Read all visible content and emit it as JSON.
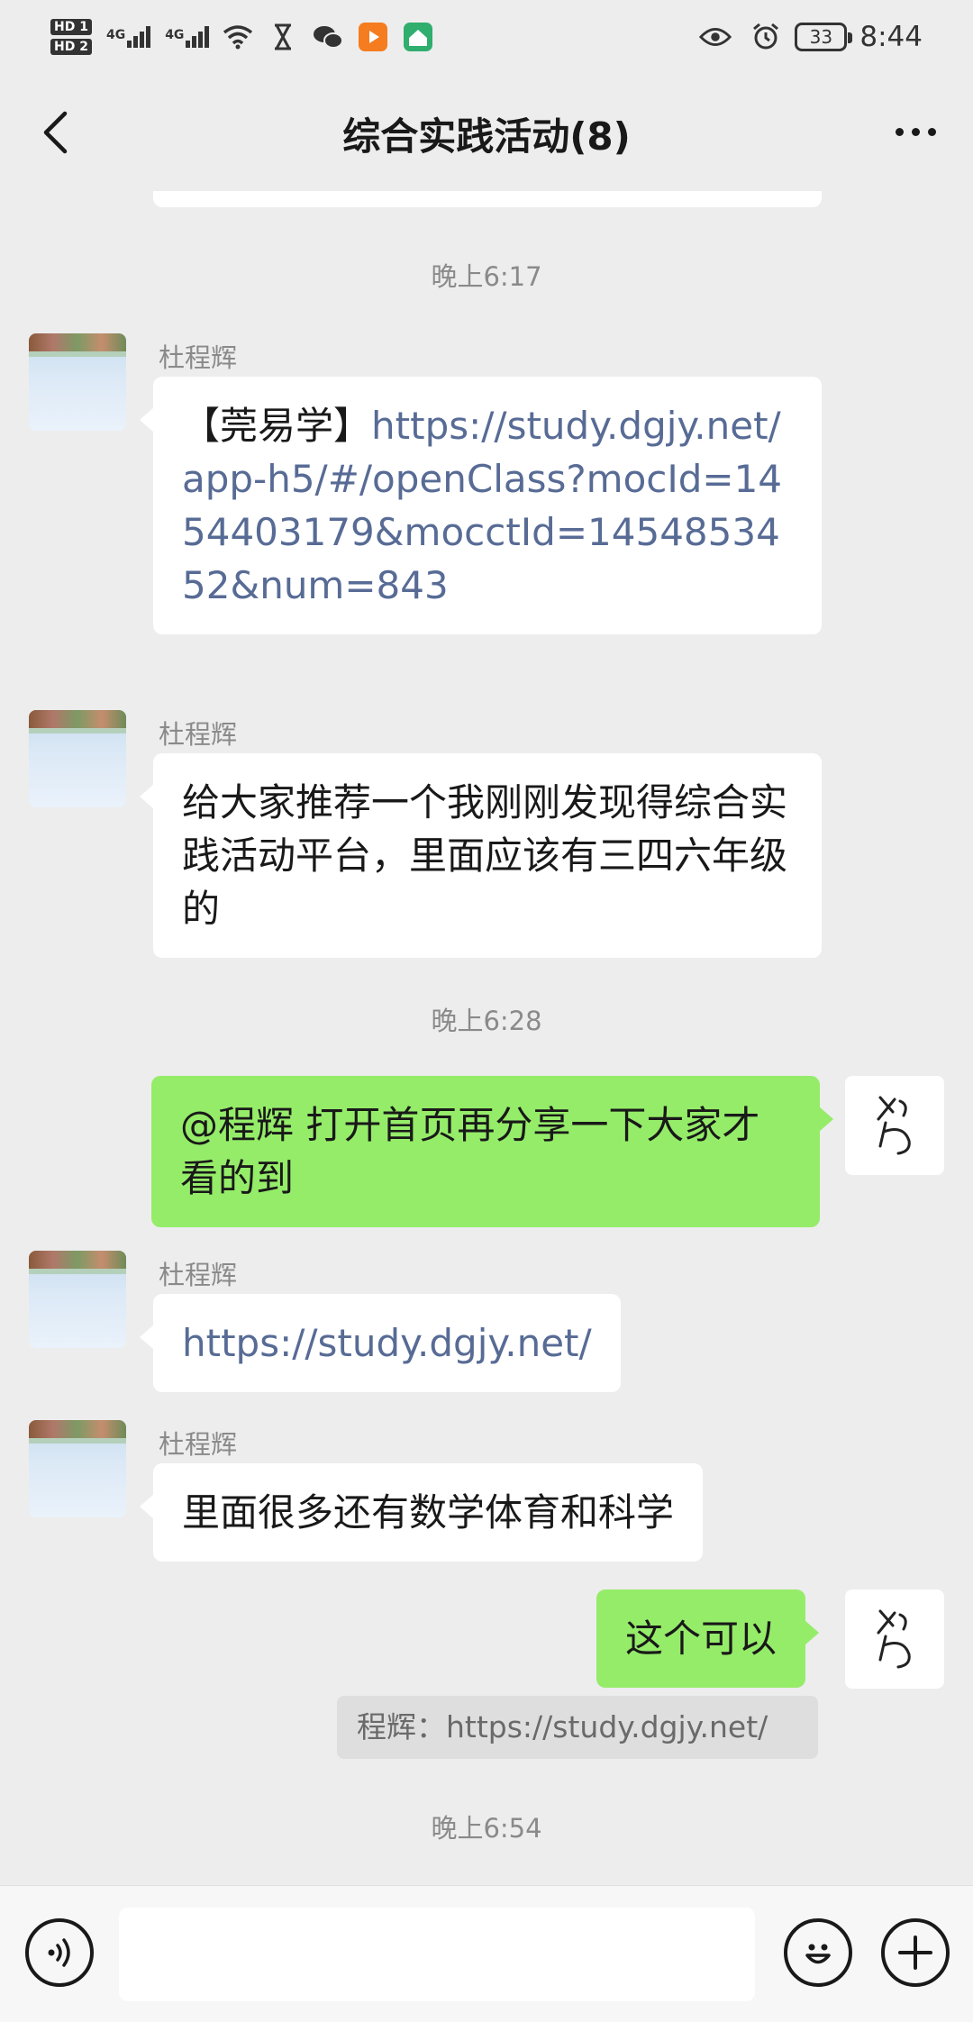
{
  "status_bar": {
    "sim1_label": "HD 1",
    "sim2_label": "HD 2",
    "net1": "4G",
    "net2": "4G",
    "battery": "33",
    "time": "8:44",
    "icons": [
      "signal-icon",
      "signal-icon",
      "wifi-icon",
      "hourglass-icon",
      "wechat-icon",
      "video-app-icon",
      "home-app-icon",
      "eye-icon",
      "alarm-icon",
      "battery-icon"
    ]
  },
  "header": {
    "title": "综合实践活动(8)",
    "back_icon": "chevron-left-icon",
    "more_icon": "more-dots-icon"
  },
  "messages": [
    {
      "type": "timestamp",
      "text": "晚上6:17"
    },
    {
      "type": "incoming",
      "sender": "杜程辉",
      "prefix": "【莞易学】",
      "link": "https://study.dgjy.net/app-h5/#/openClass?mocId=1454403179&mocctId=1454853452&num=843"
    },
    {
      "type": "incoming",
      "sender": "杜程辉",
      "text": "给大家推荐一个我刚刚发现得综合实践活动平台，里面应该有三四六年级的"
    },
    {
      "type": "timestamp",
      "text": "晚上6:28"
    },
    {
      "type": "outgoing",
      "text": "@程辉  打开首页再分享一下大家才看的到"
    },
    {
      "type": "incoming",
      "sender": "杜程辉",
      "link": "https://study.dgjy.net/"
    },
    {
      "type": "incoming",
      "sender": "杜程辉",
      "text": "里面很多还有数学体育和科学"
    },
    {
      "type": "outgoing",
      "text": "这个可以",
      "quote": "程辉：https://study.dgjy.net/"
    },
    {
      "type": "timestamp",
      "text": "晚上6:54"
    }
  ],
  "input_bar": {
    "value": "",
    "voice_icon": "voice-icon",
    "emoji_icon": "emoji-icon",
    "plus_icon": "plus-icon"
  },
  "colors": {
    "background": "#ededed",
    "outgoing_bubble": "#95ec69",
    "incoming_bubble": "#ffffff",
    "link": "#576b95",
    "timestamp": "#8a8a8a"
  }
}
